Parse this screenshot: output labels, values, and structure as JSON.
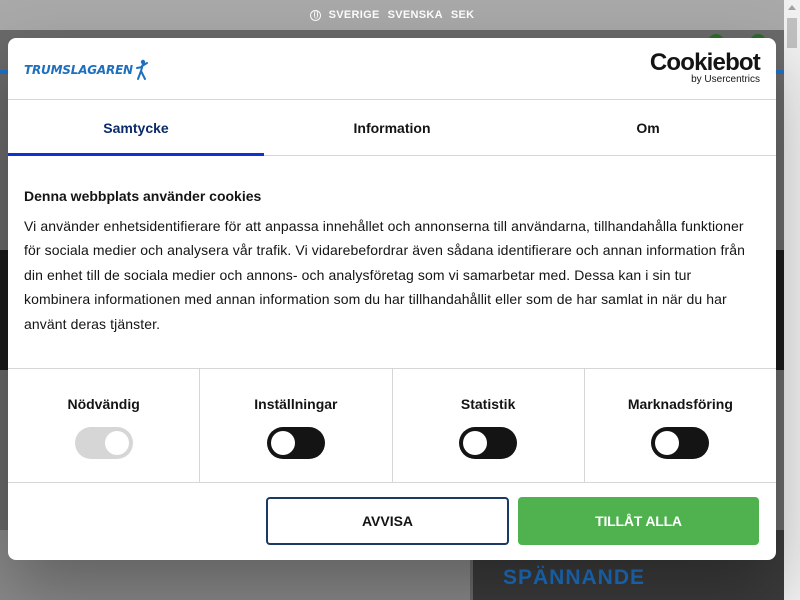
{
  "topbar": {
    "country": "SVERIGE",
    "language": "SVENSKA",
    "currency": "SEK",
    "icon": "globe-icon"
  },
  "background": {
    "promo_text": "SPÄNNANDE"
  },
  "dialog": {
    "brand_name": "TRUMSLAGAREN",
    "cookiebot": {
      "main": "Cookiebot",
      "sub": "by Usercentrics"
    },
    "tabs": [
      {
        "label": "Samtycke",
        "active": true
      },
      {
        "label": "Information",
        "active": false
      },
      {
        "label": "Om",
        "active": false
      }
    ],
    "heading": "Denna webbplats använder cookies",
    "body": "Vi använder enhetsidentifierare för att anpassa innehållet och annonserna till användarna, tillhandahålla funktioner för sociala medier och analysera vår trafik. Vi vidarebefordrar även sådana identifierare och annan information från din enhet till de sociala medier och annons- och analysföretag som vi samarbetar med. Dessa kan i sin tur kombinera informationen med annan information som du har tillhandahållit eller som de har samlat in när du har använt deras tjänster.",
    "categories": [
      {
        "label": "Nödvändig",
        "enabled": true,
        "locked": true
      },
      {
        "label": "Inställningar",
        "enabled": false,
        "locked": false
      },
      {
        "label": "Statistik",
        "enabled": false,
        "locked": false
      },
      {
        "label": "Marknadsföring",
        "enabled": false,
        "locked": false
      }
    ],
    "buttons": {
      "deny": "AVVISA",
      "allow": "TILLÅT ALLA"
    }
  },
  "colors": {
    "accent": "#1032cf",
    "allow": "#4fb24f",
    "deny_border": "#1a3a63",
    "brand": "#1f6fbf"
  }
}
